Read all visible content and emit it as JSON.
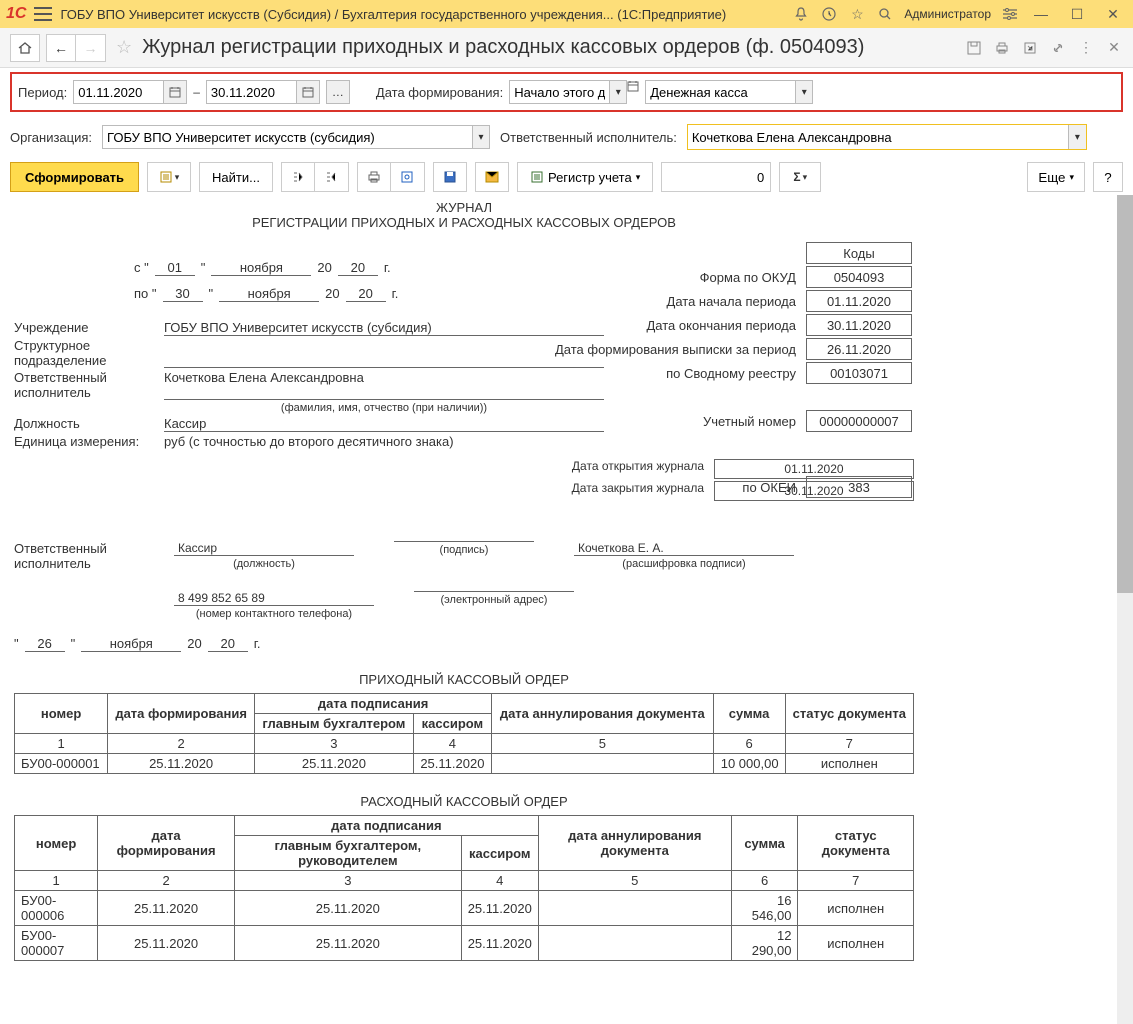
{
  "titlebar": {
    "app_title": "ГОБУ ВПО Университет искусств (Субсидия) / Бухгалтерия государственного учреждения...   (1С:Предприятие)",
    "user": "Администратор"
  },
  "page": {
    "title": "Журнал регистрации приходных и расходных кассовых ордеров (ф. 0504093)"
  },
  "filters": {
    "period_label": "Период:",
    "date_from": "01.11.2020",
    "date_sep": "–",
    "date_to": "30.11.2020",
    "form_date_label": "Дата формирования:",
    "form_date_value": "Начало этого дня",
    "cash_value": "Денежная касса"
  },
  "org": {
    "label": "Организация:",
    "value": "ГОБУ ВПО Университет искусств (субсидия)",
    "resp_label": "Ответственный исполнитель:",
    "resp_value": "Кочеткова Елена Александровна"
  },
  "actions": {
    "form": "Сформировать",
    "find": "Найти...",
    "registry": "Регистр учета",
    "num": "0",
    "more": "Еще"
  },
  "report": {
    "title1": "ЖУРНАЛ",
    "title2": "РЕГИСТРАЦИИ ПРИХОДНЫХ И РАСХОДНЫХ КАССОВЫХ ОРДЕРОВ",
    "from_label": "с \"",
    "from_day": "01",
    "from_month": "ноября",
    "from_y20": "20",
    "from_year": "20",
    "year_g": "г.",
    "to_label": "по \"",
    "to_day": "30",
    "to_month": "ноября",
    "to_y20": "20",
    "to_year": "20",
    "codes_header": "Коды",
    "okud_label": "Форма по ОКУД",
    "okud": "0504093",
    "start_label": "Дата начала периода",
    "start": "01.11.2020",
    "end_label": "Дата окончания периода",
    "end": "30.11.2020",
    "vyp_label": "Дата формирования выписки за период",
    "vyp": "26.11.2020",
    "svod_label": "по Сводному реестру",
    "svod": "00103071",
    "uch_label": "Учетный номер",
    "uch": "00000000007",
    "okei_label": "по ОКЕИ",
    "okei": "383",
    "org_label": "Учреждение",
    "org_value": "ГОБУ ВПО Университет искусств (субсидия)",
    "struct_label": "Структурное подразделение",
    "resp_label": "Ответственный исполнитель",
    "resp_value": "Кочеткова Елена Александровна",
    "resp_note": "(фамилия, имя, отчество (при наличии))",
    "pos_label": "Должность",
    "pos_value": "Кассир",
    "unit_label": "Единица измерения:",
    "unit_value": "руб (с точностью до второго десятичного знака)",
    "open_label": "Дата открытия журнала",
    "open": "01.11.2020",
    "close_label": "Дата закрытия журнала",
    "close": "30.11.2020",
    "sign_resp_label": "Ответственный исполнитель",
    "sign_pos": "Кассир",
    "sign_pos_note": "(должность)",
    "sign_sig_note": "(подпись)",
    "sign_name": "Кочеткова Е. А.",
    "sign_name_note": "(расшифровка подписи)",
    "phone": "8 499 852 65 89",
    "phone_note": "(номер контактного телефона)",
    "email_note": "(электронный адрес)",
    "quote": "\"",
    "sig_day": "26",
    "sig_month": "ноября",
    "sig_y20": "20",
    "sig_year": "20"
  },
  "income": {
    "title": "ПРИХОДНЫЙ КАССОВЫЙ ОРДЕР",
    "h_num": "номер",
    "h_formdate": "дата формирования",
    "h_signdate": "дата подписания",
    "h_sign_main": "главным бухгалтером",
    "h_sign_cashier": "кассиром",
    "h_cancel": "дата аннулирования документа",
    "h_sum": "сумма",
    "h_status": "статус документа",
    "n1": "1",
    "n2": "2",
    "n3": "3",
    "n4": "4",
    "n5": "5",
    "n6": "6",
    "n7": "7",
    "rows": [
      {
        "num": "БУ00-000001",
        "fdate": "25.11.2020",
        "s1": "25.11.2020",
        "s2": "25.11.2020",
        "cancel": "",
        "sum": "10 000,00",
        "status": "исполнен"
      }
    ]
  },
  "expense": {
    "title": "РАСХОДНЫЙ КАССОВЫЙ ОРДЕР",
    "h_num": "номер",
    "h_formdate": "дата формирования",
    "h_signdate": "дата подписания",
    "h_sign_main": "главным бухгалтером, руководителем",
    "h_sign_cashier": "кассиром",
    "h_cancel": "дата аннулирования документа",
    "h_sum": "сумма",
    "h_status": "статус документа",
    "n1": "1",
    "n2": "2",
    "n3": "3",
    "n4": "4",
    "n5": "5",
    "n6": "6",
    "n7": "7",
    "rows": [
      {
        "num": "БУ00-000006",
        "fdate": "25.11.2020",
        "s1": "25.11.2020",
        "s2": "25.11.2020",
        "cancel": "",
        "sum": "16 546,00",
        "status": "исполнен"
      },
      {
        "num": "БУ00-000007",
        "fdate": "25.11.2020",
        "s1": "25.11.2020",
        "s2": "25.11.2020",
        "cancel": "",
        "sum": "12 290,00",
        "status": "исполнен"
      }
    ]
  }
}
